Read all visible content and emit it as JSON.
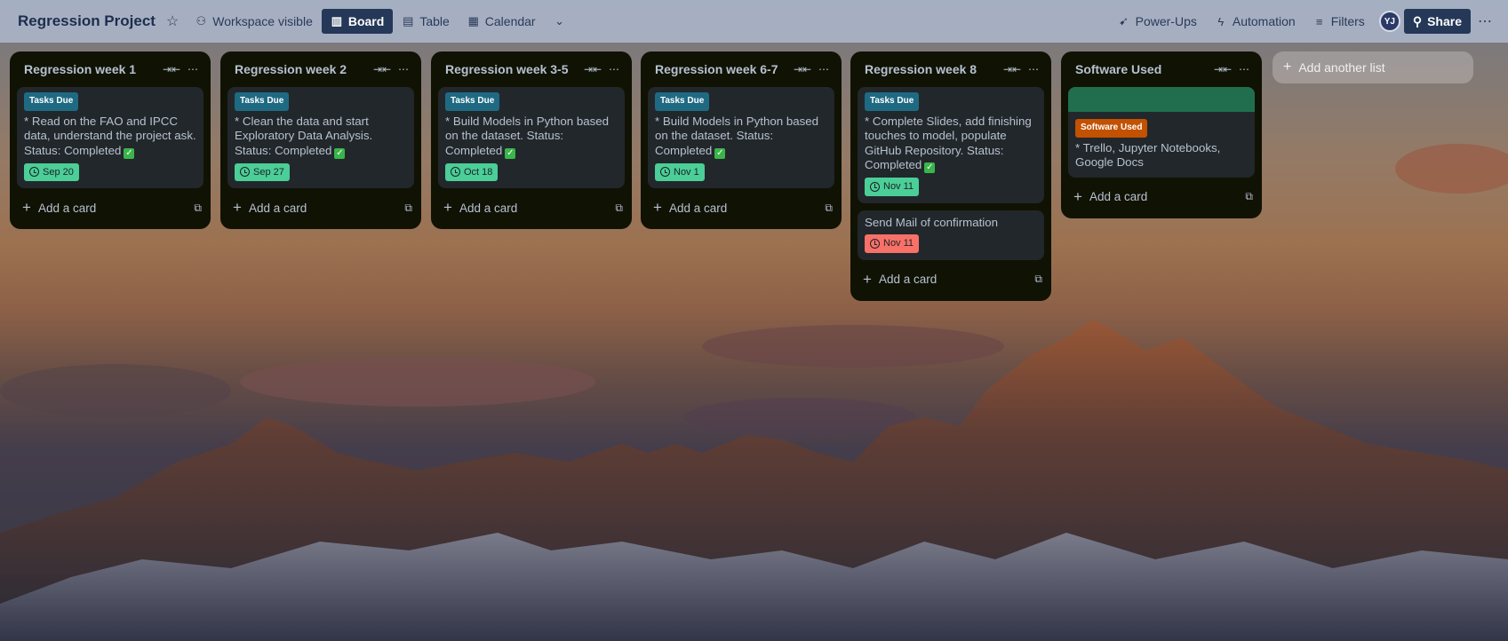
{
  "header": {
    "board_title": "Regression Project",
    "visibility_label": "Workspace visible",
    "views": [
      {
        "label": "Board",
        "icon": "board-icon",
        "active": true
      },
      {
        "label": "Table",
        "icon": "table-icon"
      },
      {
        "label": "Calendar",
        "icon": "calendar-icon"
      }
    ],
    "power_ups_label": "Power-Ups",
    "automation_label": "Automation",
    "filters_label": "Filters",
    "avatar_initials": "YJ",
    "share_label": "Share"
  },
  "lists": [
    {
      "title": "Regression week 1",
      "cards": [
        {
          "label": "Tasks Due",
          "text": "* Read on the FAO and IPCC data, understand the project ask. Status: Completed",
          "checked": true,
          "due": "Sep 20",
          "due_status": "complete"
        }
      ]
    },
    {
      "title": "Regression week 2",
      "cards": [
        {
          "label": "Tasks Due",
          "text": "* Clean the data and start Exploratory Data Analysis. Status: Completed",
          "checked": true,
          "due": "Sep 27",
          "due_status": "complete"
        }
      ]
    },
    {
      "title": "Regression week 3-5",
      "cards": [
        {
          "label": "Tasks Due",
          "text": "* Build Models in Python based on the dataset. Status: Completed",
          "checked": true,
          "due": "Oct 18",
          "due_status": "complete"
        }
      ]
    },
    {
      "title": "Regression week 6-7",
      "cards": [
        {
          "label": "Tasks Due",
          "text": "* Build Models in Python based on the dataset. Status: Completed",
          "checked": true,
          "due": "Nov 1",
          "due_status": "complete"
        }
      ]
    },
    {
      "title": "Regression week 8",
      "cards": [
        {
          "label": "Tasks Due",
          "text": "* Complete Slides, add finishing touches to model, populate GitHub Repository. Status: Completed",
          "checked": true,
          "due": "Nov 11",
          "due_status": "complete"
        },
        {
          "label": "",
          "text": "Send Mail of confirmation",
          "checked": false,
          "due": "Nov 11",
          "due_status": "overdue"
        }
      ]
    },
    {
      "title": "Software Used",
      "cards": [
        {
          "cover": true,
          "label": "Software Used",
          "label_color": "orange",
          "text": "* Trello, Jupyter Notebooks, Google Docs",
          "checked": false,
          "due": ""
        }
      ]
    }
  ],
  "add_card_label": "Add a card",
  "add_list_label": "Add another list",
  "colors": {
    "tasks_due_label": "#1f6a83",
    "software_label": "#c25100",
    "cover_green": "#216e4e",
    "due_complete": "#4bce97",
    "due_overdue": "#f87168",
    "list_bg": "#101204",
    "card_bg": "#22272b"
  }
}
